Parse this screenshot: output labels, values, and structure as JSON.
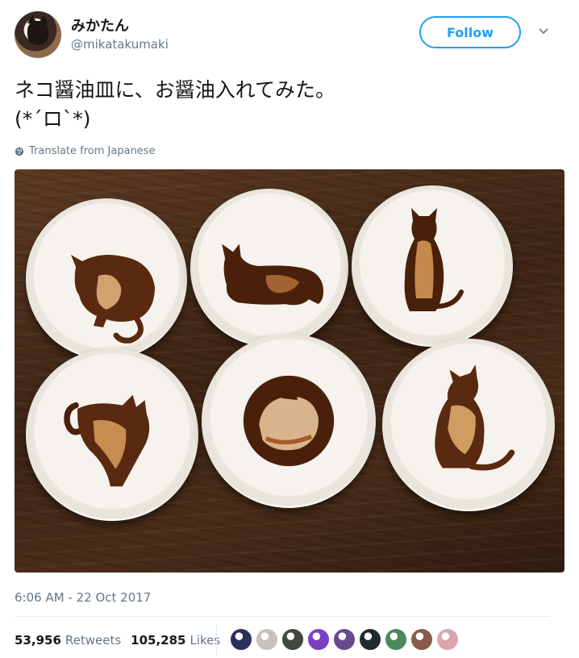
{
  "header": {
    "display_name": "みかたん",
    "handle": "@mikatakumaki",
    "follow_label": "Follow"
  },
  "tweet": {
    "text_line1": "ネコ醤油皿に、お醤油入れてみた。",
    "text_line2": "(*´ロ`*)",
    "translate_label": "Translate from Japanese"
  },
  "meta": {
    "timestamp": "6:06 AM - 22 Oct 2017",
    "retweets_count": "53,956",
    "retweets_label": "Retweets",
    "likes_count": "105,285",
    "likes_label": "Likes"
  },
  "colors": {
    "accent": "#1da1f2",
    "text": "#14171a",
    "secondary": "#657786",
    "soy_sauce": "#5a2a10"
  },
  "likers": [
    {
      "color": "#2b2f5a"
    },
    {
      "color": "#c9c2b8"
    },
    {
      "color": "#3f4a3c"
    },
    {
      "color": "#7b3fc4"
    },
    {
      "color": "#6a4a8e"
    },
    {
      "color": "#1f2a2c"
    },
    {
      "color": "#4a8a5c"
    },
    {
      "color": "#8a5a4a"
    },
    {
      "color": "#d9a6b0"
    }
  ]
}
